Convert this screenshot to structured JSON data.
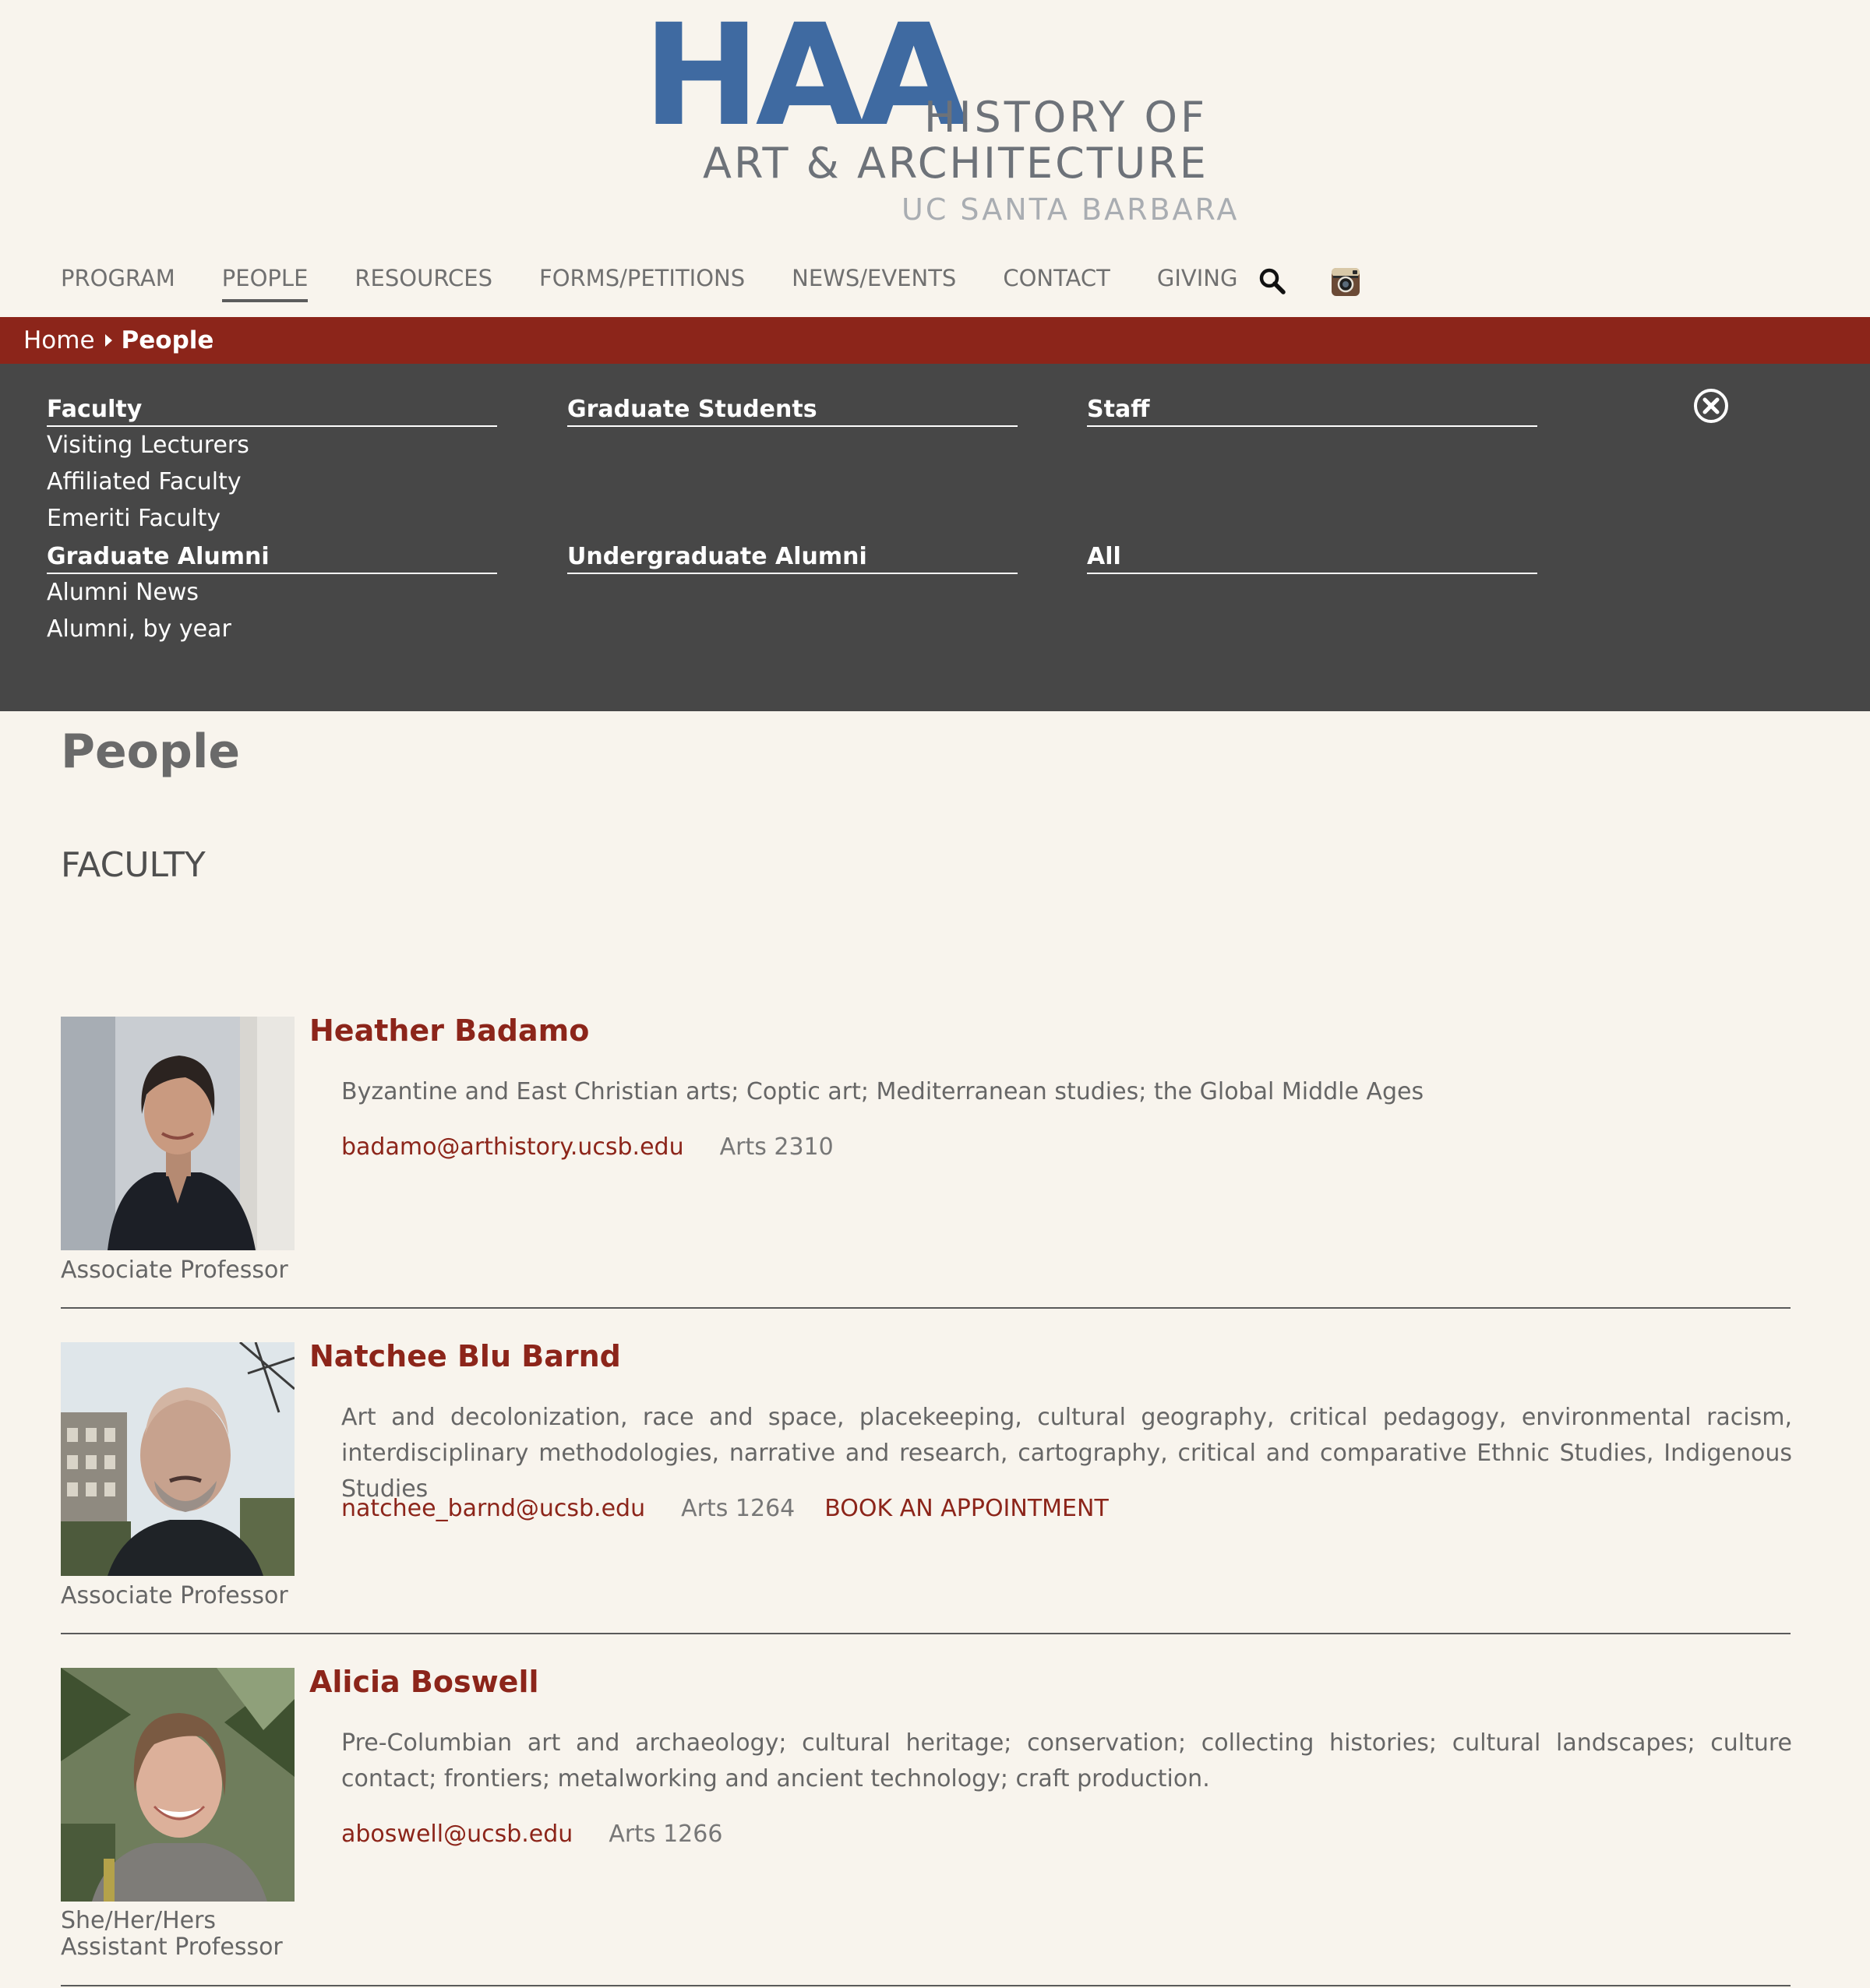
{
  "logo": {
    "abbr": "HAA",
    "line1": "HISTORY OF",
    "line2": "ART & ARCHITECTURE",
    "line3": "UC SANTA BARBARA",
    "color_primary": "#3f6aa1",
    "color_secondary": "#6d7279"
  },
  "nav": {
    "items": [
      "PROGRAM",
      "PEOPLE",
      "RESOURCES",
      "FORMS/PETITIONS",
      "NEWS/EVENTS",
      "CONTACT",
      "GIVING"
    ],
    "active": "PEOPLE",
    "icons": [
      "search-icon",
      "instagram-icon"
    ]
  },
  "breadcrumb": {
    "home": "Home",
    "current": "People",
    "bar_color": "#8c251a"
  },
  "menu": {
    "faculty": "Faculty",
    "visiting_lecturers": "Visiting Lecturers",
    "affiliated_faculty": "Affiliated Faculty",
    "emeriti_faculty": "Emeriti Faculty",
    "graduate_students": "Graduate Students",
    "staff": "Staff",
    "graduate_alumni": "Graduate Alumni",
    "alumni_news": "Alumni News",
    "alumni_by_year": "Alumni, by year",
    "undergraduate_alumni": "Undergraduate Alumni",
    "all": "All",
    "panel_color": "#474747"
  },
  "content": {
    "title": "People",
    "section": "FACULTY"
  },
  "people": [
    {
      "name": "Heather Badamo",
      "description": "Byzantine and East Christian arts; Coptic art; Mediterranean studies; the Global Middle Ages",
      "email": "badamo@arthistory.ucsb.edu",
      "room": "Arts 2310",
      "role": "Associate Professor"
    },
    {
      "name": "Natchee Blu Barnd",
      "description": "Art and decolonization, race and space, placekeeping, cultural geography, critical pedagogy, environmental racism, interdisciplinary methodologies, narrative and research, cartography, critical and comparative Ethnic Studies, Indigenous Studies",
      "email": "natchee_barnd@ucsb.edu",
      "room": "Arts 1264",
      "appointment": "BOOK AN APPOINTMENT",
      "role": "Associate Professor"
    },
    {
      "name": "Alicia Boswell",
      "description": "Pre-Columbian art and archaeology; cultural heritage; conservation; collecting histories; cultural landscapes; culture contact; frontiers; metalworking and ancient technology; craft production.",
      "email": "aboswell@ucsb.edu",
      "room": "Arts 1266",
      "pronouns": "She/Her/Hers",
      "role": "Assistant Professor"
    }
  ]
}
